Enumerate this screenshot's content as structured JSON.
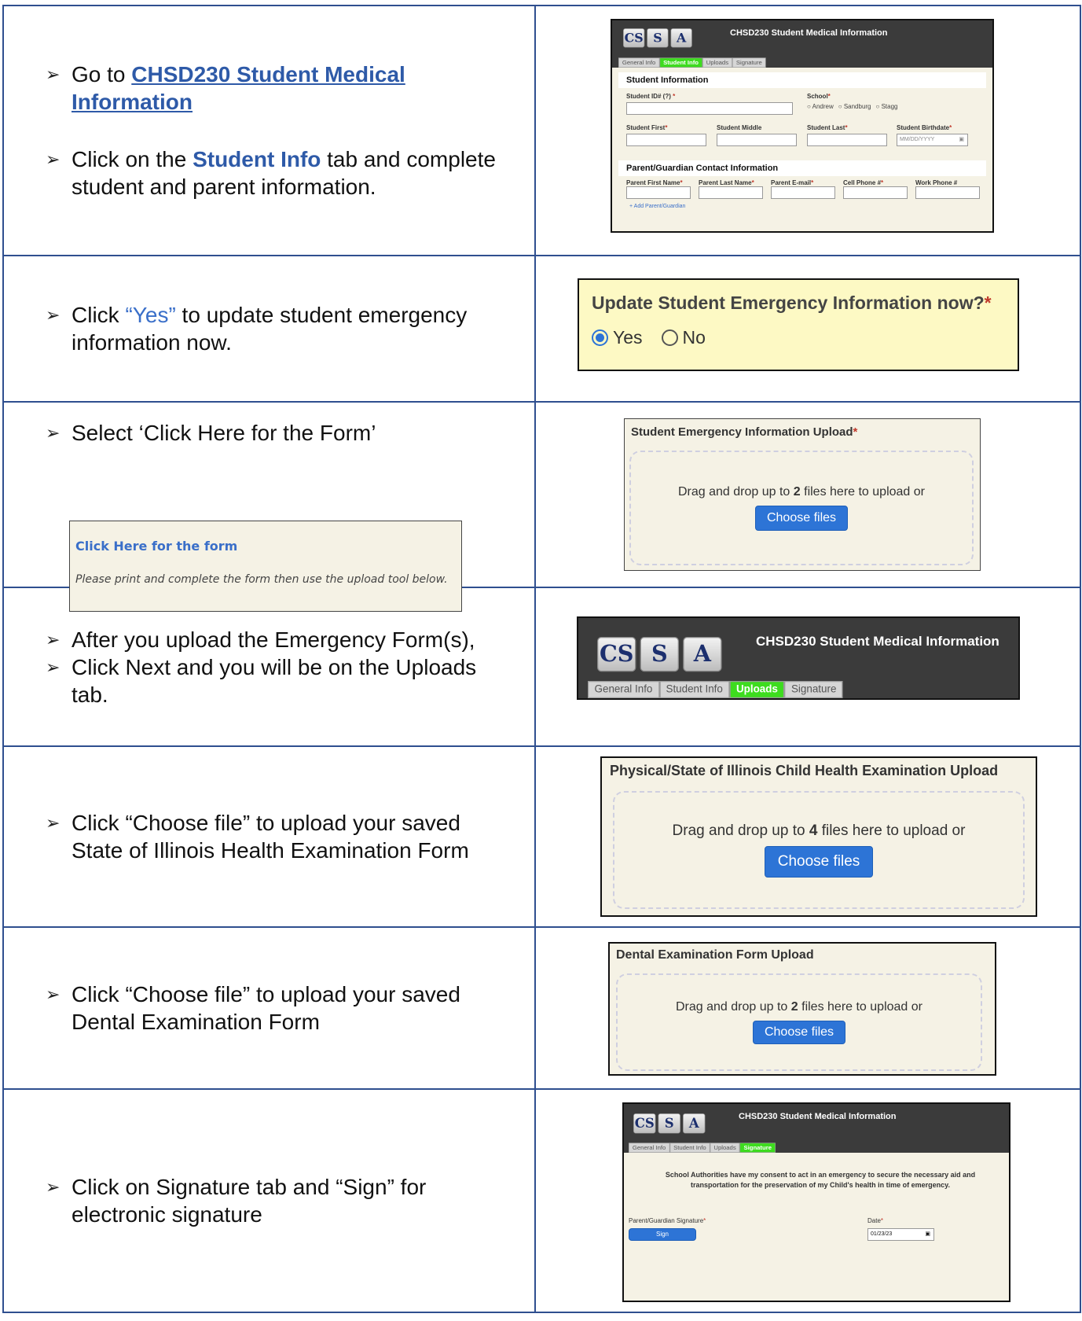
{
  "rows": [
    {
      "steps": [
        {
          "prefix": "Go to ",
          "link": "CHSD230 Student Medical Information"
        },
        {
          "prefix": "Click on the ",
          "bold": "Student Info",
          "suffix": " tab and complete student and parent information."
        }
      ],
      "screenshot": {
        "title": "CHSD230 Student Medical Information",
        "tabs": [
          "General Info",
          "Student Info",
          "Uploads",
          "Signature"
        ],
        "active_tab": "Student Info",
        "section1": "Student Information",
        "student_id_label": "Student ID# (?)",
        "school_label": "School",
        "school_options": [
          "Andrew",
          "Sandburg",
          "Stagg"
        ],
        "first_label": "Student First",
        "middle_label": "Student Middle",
        "last_label": "Student Last",
        "birthdate_label": "Student Birthdate",
        "birthdate_placeholder": "MM/DD/YYYY",
        "section2": "Parent/Guardian Contact Information",
        "parent_fields": [
          "Parent First Name",
          "Parent Last Name",
          "Parent E-mail",
          "Cell Phone #",
          "Work Phone #"
        ],
        "add_parent": "+ Add Parent/Guardian"
      }
    },
    {
      "steps": [
        {
          "prefix": "Click ",
          "quote": "“Yes”",
          "suffix": " to update student emergency information now."
        }
      ],
      "screenshot": {
        "question": "Update Student Emergency Information now?",
        "yes": "Yes",
        "no": "No"
      }
    },
    {
      "steps": [
        {
          "text": "Select ‘Click Here for the Form’"
        }
      ],
      "inset": {
        "link": "Click Here for the form",
        "note": "Please print and complete the form then use the upload tool below."
      },
      "screenshot": {
        "title": "Student Emergency Information Upload",
        "drag_before": "Drag and drop up to ",
        "count": "2",
        "drag_after": " files here to upload or",
        "button": "Choose files"
      }
    },
    {
      "steps": [
        {
          "text": "After you upload the Emergency Form(s),"
        },
        {
          "text": "Click Next and you will be on the Uploads tab."
        }
      ],
      "screenshot": {
        "title": "CHSD230 Student Medical Information",
        "tabs": [
          "General Info",
          "Student Info",
          "Uploads",
          "Signature"
        ],
        "active_tab": "Uploads"
      }
    },
    {
      "steps": [
        {
          "text": "Click “Choose file” to upload your saved State of Illinois Health Examination Form"
        }
      ],
      "screenshot": {
        "title": "Physical/State of Illinois Child Health Examination Upload",
        "drag_before": "Drag and drop up to ",
        "count": "4",
        "drag_after": " files here to upload or",
        "button": "Choose files"
      }
    },
    {
      "steps": [
        {
          "text": "Click “Choose file” to upload your saved Dental Examination Form"
        }
      ],
      "screenshot": {
        "title": "Dental Examination Form Upload",
        "drag_before": "Drag and drop up to ",
        "count": "2",
        "drag_after": " files here to upload or",
        "button": "Choose files"
      }
    },
    {
      "steps": [
        {
          "text": "Click on Signature tab and “Sign” for electronic signature"
        }
      ],
      "screenshot": {
        "title": "CHSD230 Student Medical Information",
        "tabs": [
          "General Info",
          "Student Info",
          "Uploads",
          "Signature"
        ],
        "active_tab": "Signature",
        "consent": "School Authorities have my consent to act in an emergency to secure the necessary aid and transportation for the preservation of my Child's health in time of emergency.",
        "sig_label": "Parent/Guardian Signature",
        "sign_button": "Sign",
        "date_label": "Date",
        "date_value": "01/23/23"
      }
    }
  ],
  "logos": [
    "CS",
    "S",
    "A"
  ],
  "colors": {
    "accent": "#2e5aa8",
    "active_tab": "#3ddc1e",
    "button": "#2d74d6"
  }
}
